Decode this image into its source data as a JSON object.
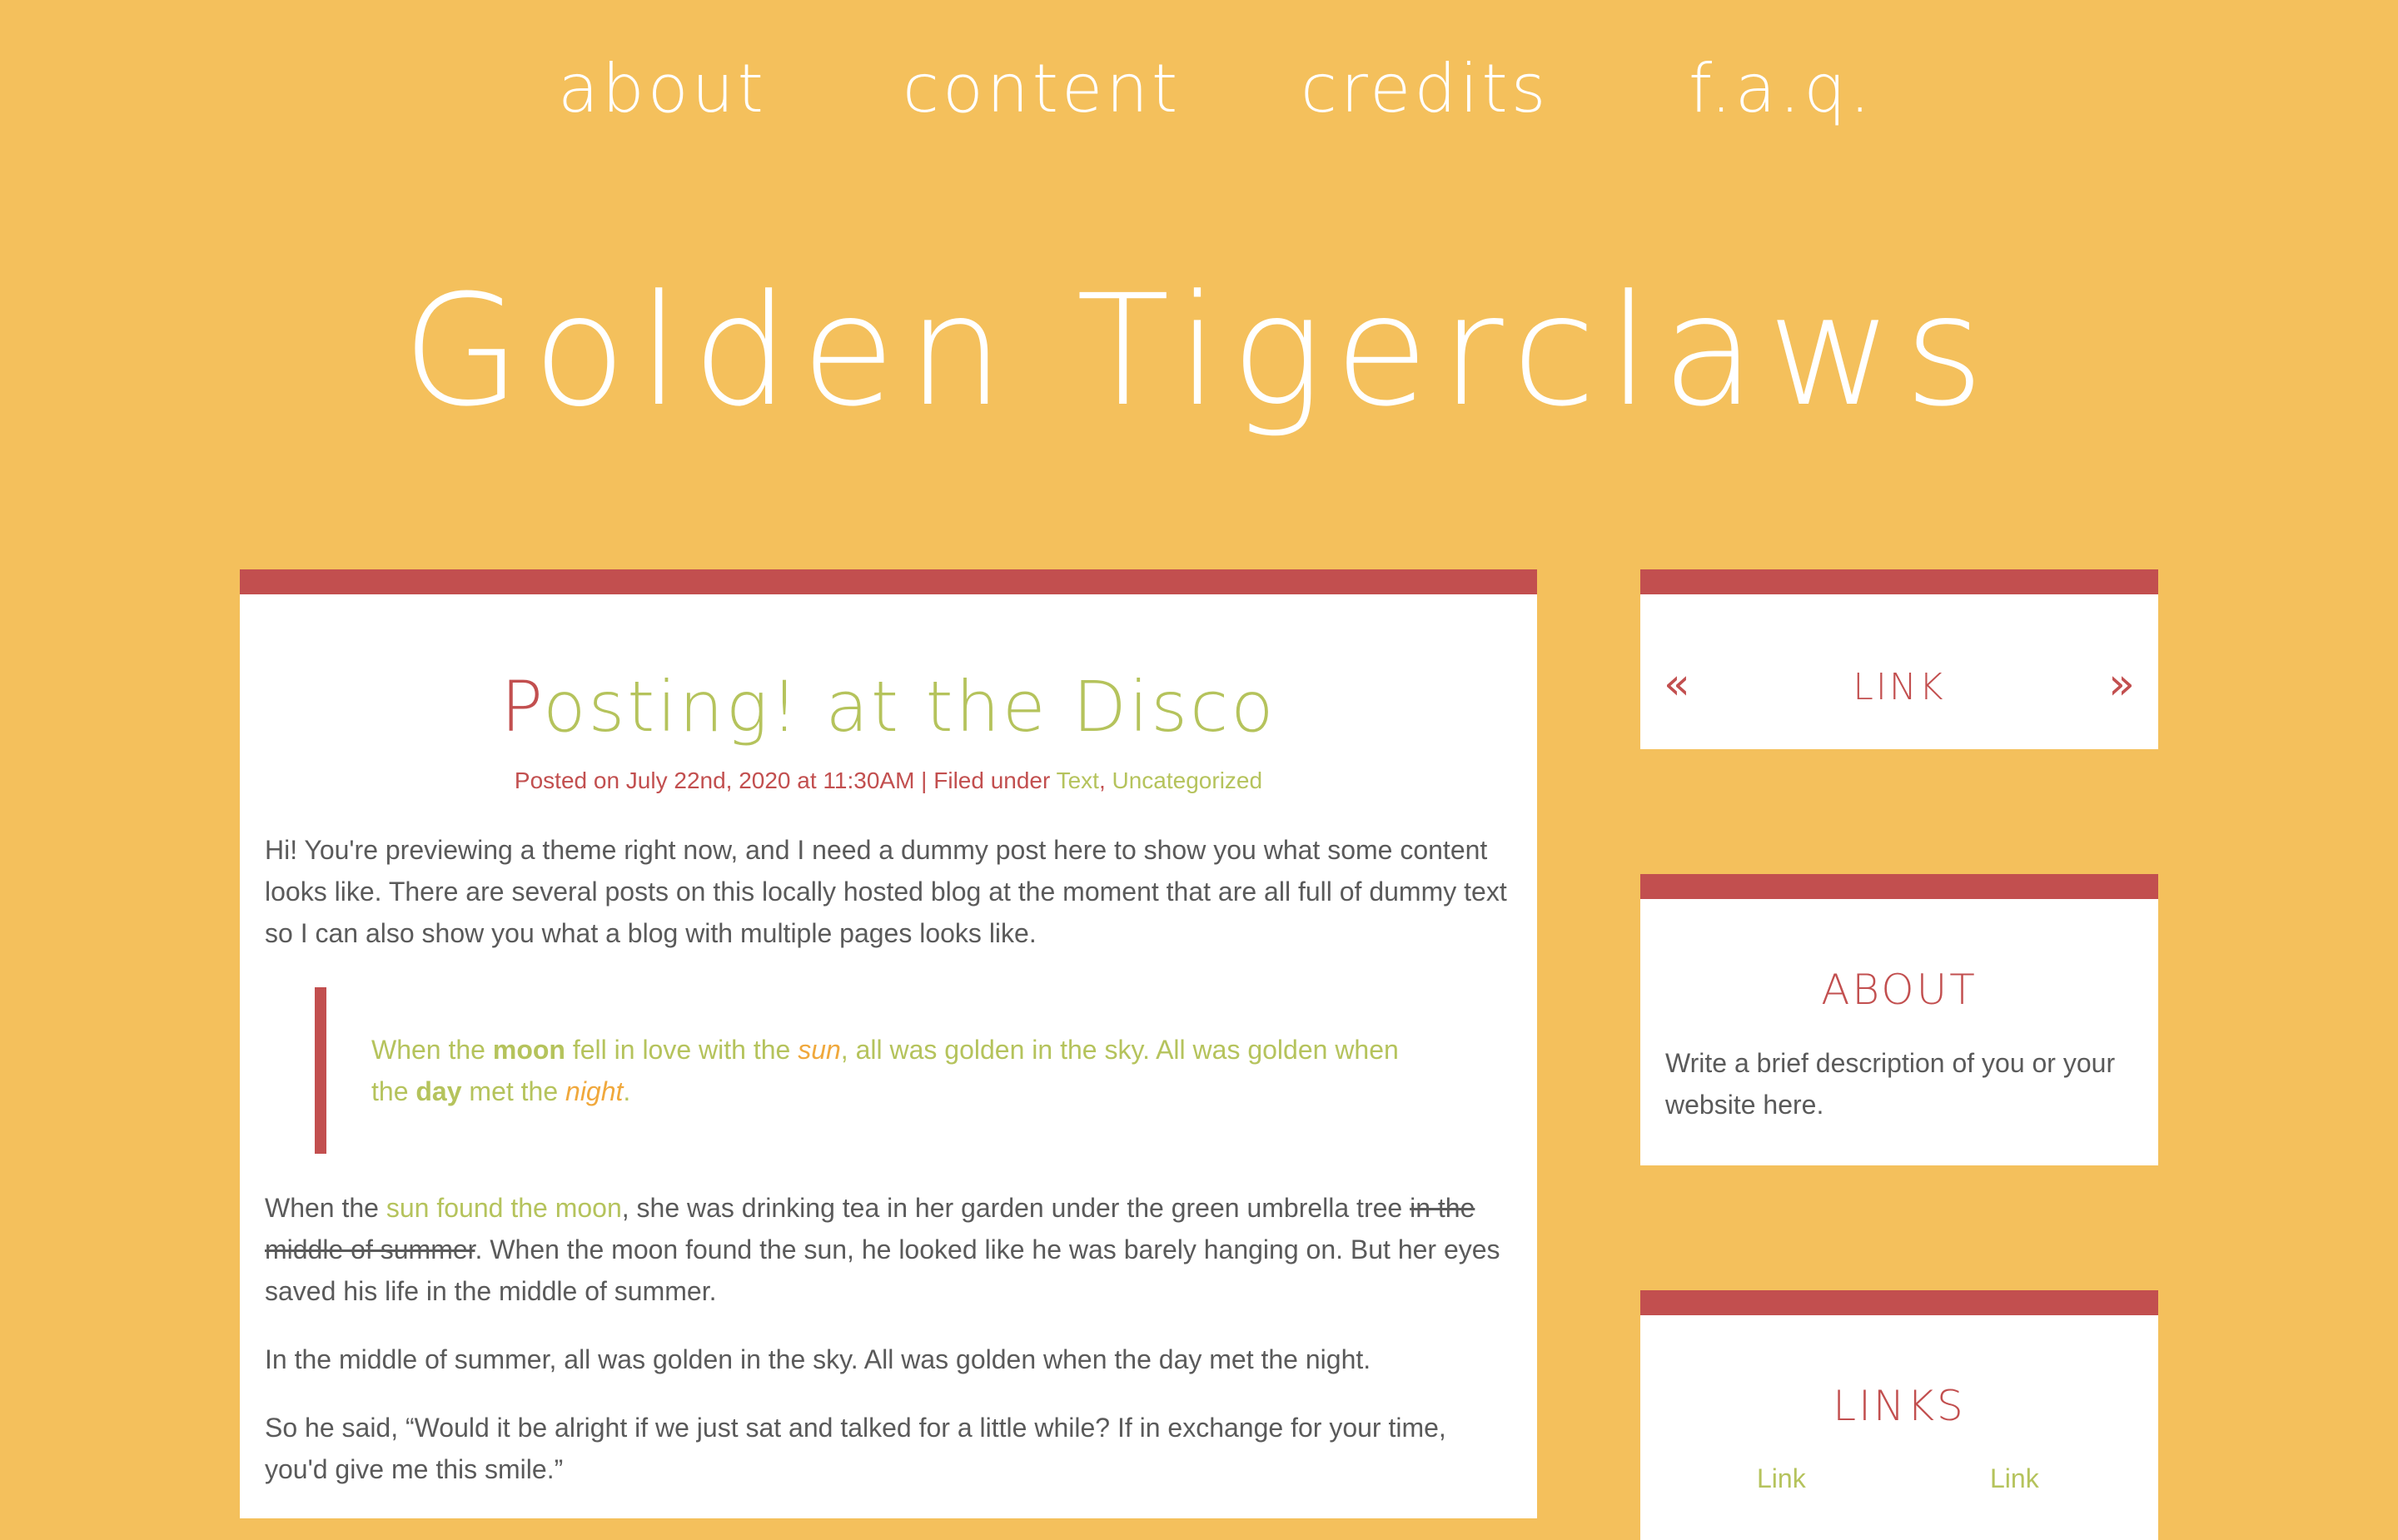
{
  "nav": {
    "items": [
      {
        "label": "about"
      },
      {
        "label": "content"
      },
      {
        "label": "credits"
      },
      {
        "label": "f.a.q."
      }
    ]
  },
  "site": {
    "title": "Golden Tigerclaws"
  },
  "post": {
    "title_first": "P",
    "title_rest": "osting! at the Disco",
    "meta": {
      "posted_prefix": "Posted on July 22nd, 2020 at 11:30AM | Filed under ",
      "category1": "Text",
      "separator": ", ",
      "category2": "Uncategorized"
    },
    "intro": "Hi! You're previewing a theme right now, and I need a dummy post here to show you what some content looks like. There are several posts on this locally hosted blog at the moment that are all full of dummy text so I can also show you what a blog with multiple pages looks like.",
    "quote": {
      "p1": "When the ",
      "moon": "moon",
      "p2": " fell in love with the ",
      "sun": "sun",
      "p3": ", all was golden in the sky. All was golden when the ",
      "day": "day",
      "p4": " met the ",
      "night": "night",
      "p5": "."
    },
    "para2": {
      "p1": "When the ",
      "link": "sun found the moon",
      "p2": ", she was drinking tea in her garden under the green umbrella tree ",
      "strike": "in the middle of summer",
      "p3": ". When the moon found the sun, he looked like he was barely hanging on. But her eyes saved his life in the middle of summer."
    },
    "para3": "In the middle of summer, all was golden in the sky. All was golden when the day met the night.",
    "para4": "So he said, “Would it be alright if we just sat and talked for a little while? If in exchange for your time, you'd give me this smile.”"
  },
  "sidebar": {
    "nav_widget": {
      "prev_icon": "«",
      "link_label": "LINK",
      "next_icon": "»"
    },
    "about_widget": {
      "heading": "ABOUT",
      "text": "Write a brief description of you or your website here."
    },
    "links_widget": {
      "heading": "LINKS",
      "links": [
        "Link",
        "Link"
      ]
    }
  },
  "colors": {
    "background": "#f4c05c",
    "accent_red": "#c24f4f",
    "accent_green": "#b5c35c",
    "accent_orange": "#f0a83c",
    "text": "#5a5a5a"
  }
}
